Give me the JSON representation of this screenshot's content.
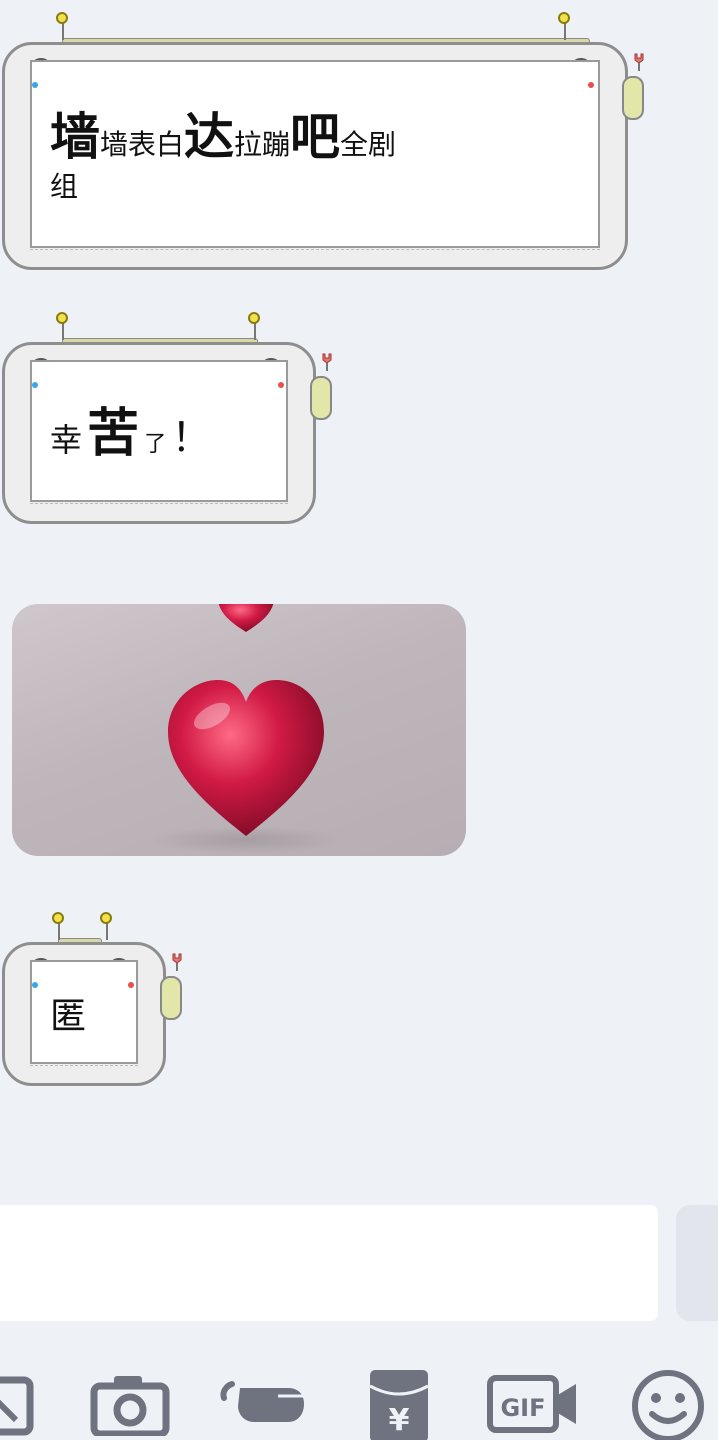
{
  "messages": [
    {
      "type": "robot-bubble",
      "text_parts": [
        "墙",
        "墙表白",
        "达",
        "拉蹦",
        "吧",
        "全剧",
        "组"
      ]
    },
    {
      "type": "robot-bubble",
      "text_parts": [
        "幸",
        "苦",
        "了",
        "！"
      ]
    },
    {
      "type": "image",
      "description": "heart"
    },
    {
      "type": "robot-bubble",
      "text_parts": [
        "匿"
      ]
    }
  ],
  "input": {
    "placeholder": ""
  },
  "toolbar": {
    "icons": [
      "image-icon",
      "camera-icon",
      "hand-point-icon",
      "red-packet-icon",
      "gif-icon",
      "emoji-icon"
    ],
    "gif_label": "GIF",
    "red_packet_label": "¥"
  },
  "colors": {
    "background": "#eef2f7",
    "icon": "#6f7380",
    "heart": "#c4123c"
  }
}
